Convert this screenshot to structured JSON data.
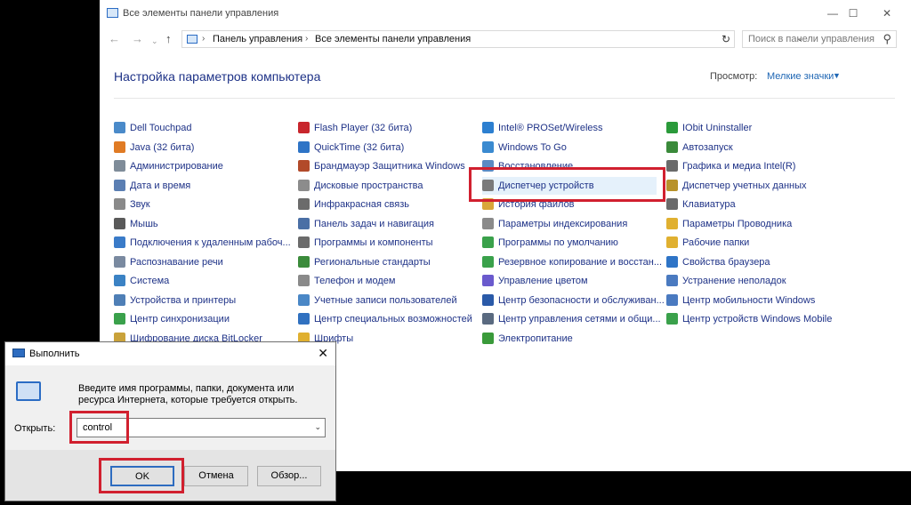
{
  "control_panel": {
    "window_title": "Все элементы панели управления",
    "window_buttons": {
      "minimize": "—",
      "maximize": "☐",
      "close": "✕"
    },
    "breadcrumbs": [
      "Панель управления",
      "Все элементы панели управления"
    ],
    "search_placeholder": "Поиск в панели управления",
    "heading": "Настройка параметров компьютера",
    "view_label": "Просмотр:",
    "view_value": "Мелкие значки",
    "columns": [
      [
        {
          "label": "Dell Touchpad",
          "color": "#4a8ac9"
        },
        {
          "label": "Java (32 бита)",
          "color": "#e07b24"
        },
        {
          "label": "Администрирование",
          "color": "#7f8c99"
        },
        {
          "label": "Дата и время",
          "color": "#5b7fb3"
        },
        {
          "label": "Звук",
          "color": "#8a8a8a"
        },
        {
          "label": "Мышь",
          "color": "#5a5a5a"
        },
        {
          "label": "Подключения к удаленным рабоч...",
          "color": "#3a7bc8"
        },
        {
          "label": "Распознавание речи",
          "color": "#7a8aa0"
        },
        {
          "label": "Система",
          "color": "#3b82c4"
        },
        {
          "label": "Устройства и принтеры",
          "color": "#4f7fb6"
        },
        {
          "label": "Центр синхронизации",
          "color": "#3aa14b"
        },
        {
          "label": "Шифрование диска BitLocker",
          "color": "#c9a23a"
        }
      ],
      [
        {
          "label": "Flash Player (32 бита)",
          "color": "#c8262d"
        },
        {
          "label": "QuickTime (32 бита)",
          "color": "#2e74c6"
        },
        {
          "label": "Брандмауэр Защитника Windows",
          "color": "#b24a2a"
        },
        {
          "label": "Дисковые пространства",
          "color": "#8c8c8c"
        },
        {
          "label": "Инфракрасная связь",
          "color": "#6b6b6b"
        },
        {
          "label": "Панель задач и навигация",
          "color": "#4a6fa5"
        },
        {
          "label": "Программы и компоненты",
          "color": "#6b6b6b"
        },
        {
          "label": "Региональные стандарты",
          "color": "#3b8b3b"
        },
        {
          "label": "Телефон и модем",
          "color": "#8a8a8a"
        },
        {
          "label": "Учетные записи пользователей",
          "color": "#4a87c6"
        },
        {
          "label": "Центр специальных возможностей",
          "color": "#3071c0"
        },
        {
          "label": "Шрифты",
          "color": "#e0b030"
        }
      ],
      [
        {
          "label": "Intel® PROSet/Wireless",
          "color": "#2c7fd0"
        },
        {
          "label": "Windows To Go",
          "color": "#3a8ad0"
        },
        {
          "label": "Восстановление",
          "color": "#5b8ac4"
        },
        {
          "label": "Диспетчер устройств",
          "color": "#7a7a7a",
          "highlight": true
        },
        {
          "label": "История файлов",
          "color": "#d9a63a"
        },
        {
          "label": "Параметры индексирования",
          "color": "#8a8a8a"
        },
        {
          "label": "Программы по умолчанию",
          "color": "#3aa14b"
        },
        {
          "label": "Резервное копирование и восстан...",
          "color": "#3aa14b"
        },
        {
          "label": "Управление цветом",
          "color": "#6a5acd"
        },
        {
          "label": "Центр безопасности и обслуживан...",
          "color": "#2a5aa8"
        },
        {
          "label": "Центр управления сетями и общи...",
          "color": "#5a6a80"
        },
        {
          "label": "Электропитание",
          "color": "#3a9a3a"
        }
      ],
      [
        {
          "label": "IObit Uninstaller",
          "color": "#2a9a3a"
        },
        {
          "label": "Автозапуск",
          "color": "#3a8a3a"
        },
        {
          "label": "Графика и медиа Intel(R)",
          "color": "#6a6a6a"
        },
        {
          "label": "Диспетчер учетных данных",
          "color": "#b8922a"
        },
        {
          "label": "Клавиатура",
          "color": "#6a6a6a"
        },
        {
          "label": "Параметры Проводника",
          "color": "#e0b030"
        },
        {
          "label": "Рабочие папки",
          "color": "#e0b030"
        },
        {
          "label": "Свойства браузера",
          "color": "#2e74c6"
        },
        {
          "label": "Устранение неполадок",
          "color": "#4a7ac0"
        },
        {
          "label": "Центр мобильности Windows",
          "color": "#4a7ac0"
        },
        {
          "label": "Центр устройств Windows Mobile",
          "color": "#3aa14b"
        }
      ]
    ]
  },
  "run_dialog": {
    "title": "Выполнить",
    "close": "✕",
    "description": "Введите имя программы, папки, документа или ресурса Интернета, которые требуется открыть.",
    "open_label": "Открыть:",
    "open_value": "control",
    "buttons": {
      "ok": "OK",
      "cancel": "Отмена",
      "browse": "Обзор..."
    }
  },
  "accent_red": "#d1202f"
}
